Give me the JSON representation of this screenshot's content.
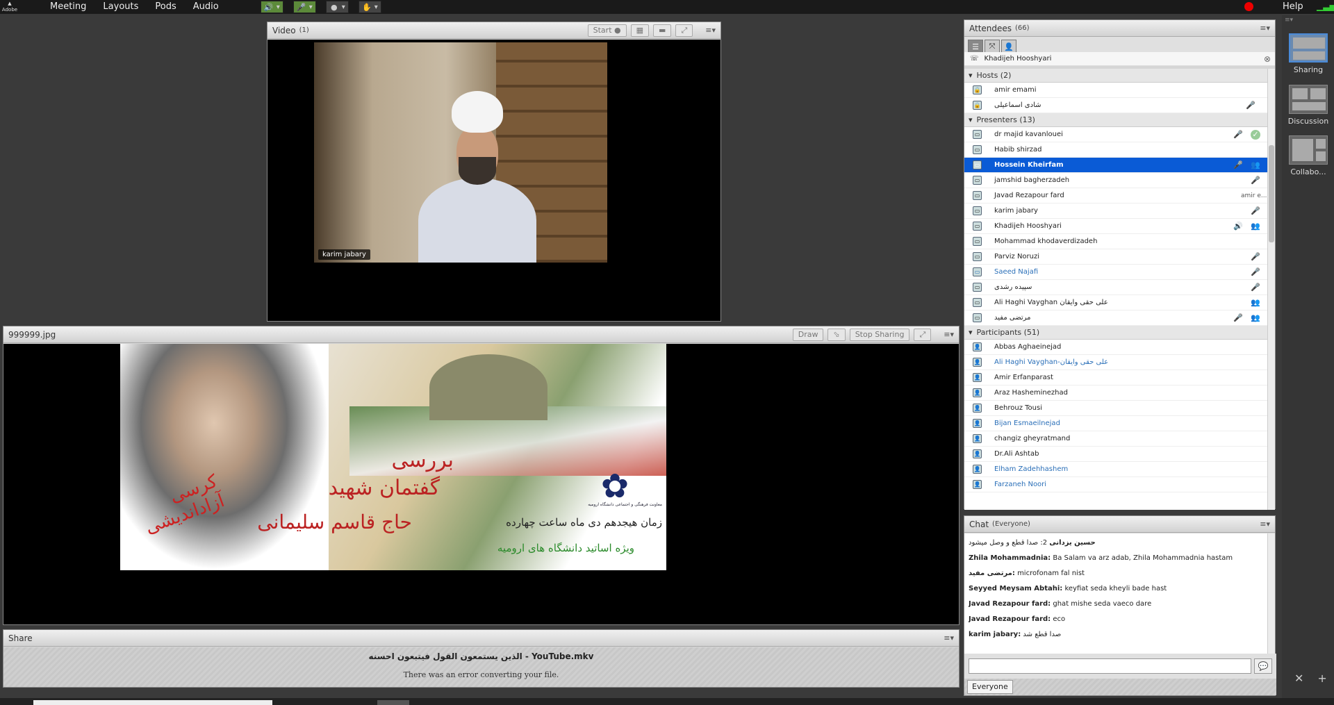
{
  "menubar": {
    "logo": "Adobe",
    "items": [
      "Meeting",
      "Layouts",
      "Pods",
      "Audio"
    ],
    "help": "Help"
  },
  "video_pod": {
    "title": "Video",
    "count": "(1)",
    "start_label": "Start",
    "speaker_label": "karim jabary"
  },
  "share_image_pod": {
    "title": "999999.jpg",
    "draw_label": "Draw",
    "stop_sharing_label": "Stop Sharing",
    "poster_lines": [
      "بررسی",
      "گفتمان شهید",
      "حاج قاسم سلیمانی",
      "کرسی آزاداندیشی",
      "زمان هیجدهم دی ماه ساعت چهارده",
      "ویژه اساتید دانشگاه های ارومیه",
      "معاونت فرهنگی و اجتماعی دانشگاه ارومیه"
    ]
  },
  "share_pod": {
    "title": "Share",
    "filename": "الذين يستمعون القول فيتبعون احسنه - YouTube.mkv",
    "error": "There was an error converting your file."
  },
  "attendees": {
    "title": "Attendees",
    "count": "(66)",
    "talking": "Khadijeh Hooshyari",
    "hosts_label": "Hosts (2)",
    "hosts": [
      {
        "name": "amir emami",
        "status": ""
      },
      {
        "name": "شادی اسماعیلی",
        "status": "mic-off"
      }
    ],
    "presenters_label": "Presenters (13)",
    "presenters": [
      {
        "name": "dr majid kavanlouei",
        "status": "mic-off",
        "extra": "check"
      },
      {
        "name": "Habib shirzad",
        "status": ""
      },
      {
        "name": "Hossein Kheirfam",
        "status": "mic-off",
        "extra": "cam",
        "selected": true
      },
      {
        "name": "jamshid bagherzadeh",
        "status": "mic-off"
      },
      {
        "name": "Javad Rezapour fard",
        "status": ""
      },
      {
        "name": "karim jabary",
        "status": "mic-off"
      },
      {
        "name": "Khadijeh Hooshyari",
        "status": "speaking",
        "extra": "cam"
      },
      {
        "name": "Mohammad khodaverdizadeh",
        "status": ""
      },
      {
        "name": "Parviz Noruzi",
        "status": "mic-off"
      },
      {
        "name": "Saeed Najafi",
        "status": "mic-off",
        "blue": true
      },
      {
        "name": "سپیده رشدی",
        "status": "mic-off"
      },
      {
        "name": "Ali Haghi Vayghan علی حقی وایقان",
        "status": "",
        "extra": "cam"
      },
      {
        "name": "مرتضی مفید",
        "status": "mic-off",
        "extra": "cam"
      }
    ],
    "participants_label": "Participants (51)",
    "participants": [
      {
        "name": "Abbas Aghaeinejad"
      },
      {
        "name": "Ali Haghi Vayghan-علی حقی وایقان",
        "blue": true
      },
      {
        "name": "Amir Erfanparast"
      },
      {
        "name": "Araz Hasheminezhad"
      },
      {
        "name": "Behrouz Tousi"
      },
      {
        "name": "Bijan Esmaeilnejad",
        "blue": true
      },
      {
        "name": "changiz gheyratmand"
      },
      {
        "name": "Dr.Ali Ashtab"
      },
      {
        "name": "Elham Zadehhashem",
        "blue": true
      },
      {
        "name": "Farzaneh Noori",
        "blue": true
      }
    ],
    "tooltip": "amir e..."
  },
  "chat": {
    "title": "Chat",
    "scope": "(Everyone)",
    "messages": [
      {
        "from": "حسین یزدانی",
        "text": "2: صدا قطع و وصل میشود"
      },
      {
        "from": "Zhila Mohammadnia:",
        "text": "Ba Salam va arz adab, Zhila Mohammadnia hastam"
      },
      {
        "from": "مرتضی مفید:",
        "text": "microfonam fal nist"
      },
      {
        "from": "Seyyed Meysam Abtahi:",
        "text": "keyfiat seda kheyli bade hast"
      },
      {
        "from": "Javad Rezapour fard:",
        "text": "ghat mishe seda vaeco dare"
      },
      {
        "from": "Javad Rezapour fard:",
        "text": "eco"
      },
      {
        "from": "karim jabary:",
        "text": "صدا قطع شد"
      }
    ],
    "everyone_label": "Everyone"
  },
  "layouts": {
    "items": [
      {
        "label": "Sharing",
        "active": true
      },
      {
        "label": "Discussion",
        "active": false
      },
      {
        "label": "Collabo...",
        "active": false
      }
    ]
  },
  "colors": {
    "selection": "#0a5bd6",
    "link_blue": "#2a6fb8",
    "record": "#e00000"
  }
}
